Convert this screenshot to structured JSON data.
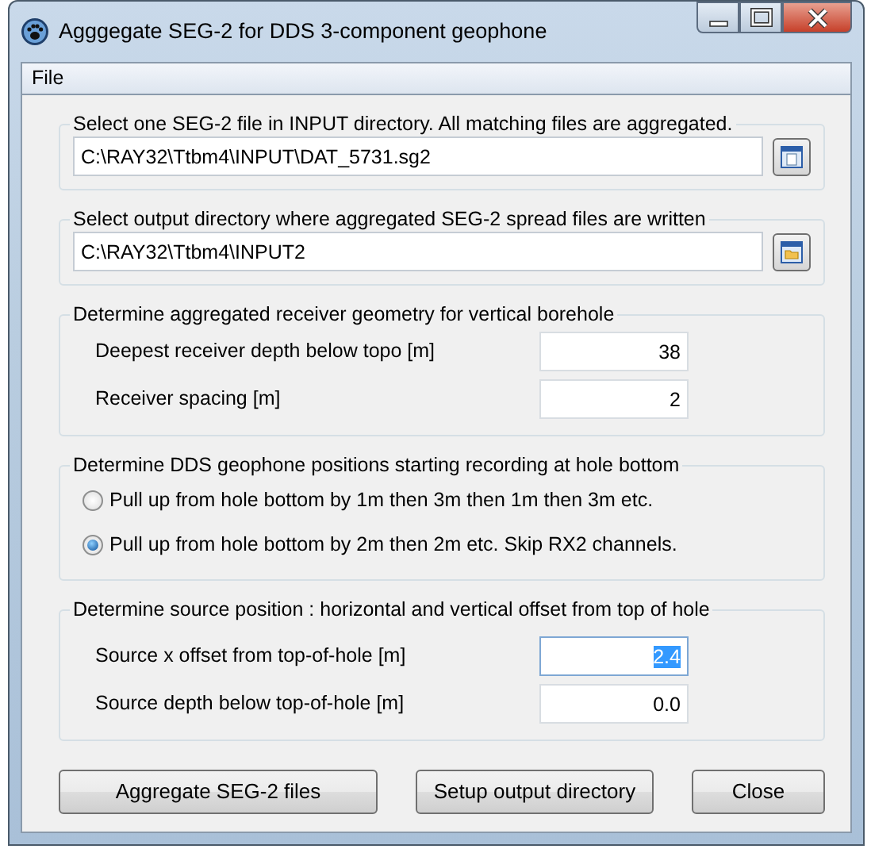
{
  "window": {
    "title": "Agggegate SEG-2 for DDS 3-component geophone"
  },
  "menu": [
    "File"
  ],
  "groups": [
    {
      "kind": "file",
      "legend": "Select one SEG-2 file in INPUT directory. All matching files are aggregated.",
      "value": "C:\\RAY32\\Ttbm4\\INPUT\\DAT_5731.sg2"
    },
    {
      "kind": "folder",
      "legend": "Select output directory where aggregated SEG-2 spread files are written",
      "value": "C:\\RAY32\\Ttbm4\\INPUT2"
    },
    {
      "kind": "numbers",
      "legend": "Determine aggregated receiver geometry for vertical borehole",
      "fields": [
        {
          "label": "Deepest receiver depth below topo [m]",
          "value": "38",
          "focused": false
        },
        {
          "label": "Receiver spacing [m]",
          "value": "2",
          "focused": false
        }
      ]
    },
    {
      "kind": "radios",
      "legend": "Determine DDS geophone positions starting recording at hole bottom",
      "options": [
        {
          "label": "Pull up from hole bottom by 1m then 3m then 1m then 3m etc.",
          "selected": false
        },
        {
          "label": "Pull up from hole bottom by 2m then 2m etc. Skip RX2 channels.",
          "selected": true
        }
      ]
    },
    {
      "kind": "numbers",
      "legend": "Determine source position : horizontal and vertical offset from top of hole",
      "fields": [
        {
          "label": "Source x offset from top-of-hole [m]",
          "value": "2.4",
          "focused": true
        },
        {
          "label": "Source depth below top-of-hole [m]",
          "value": "0.0",
          "focused": false
        }
      ]
    }
  ],
  "buttons": [
    "Aggregate SEG-2 files",
    "Setup output directory",
    "Close"
  ]
}
